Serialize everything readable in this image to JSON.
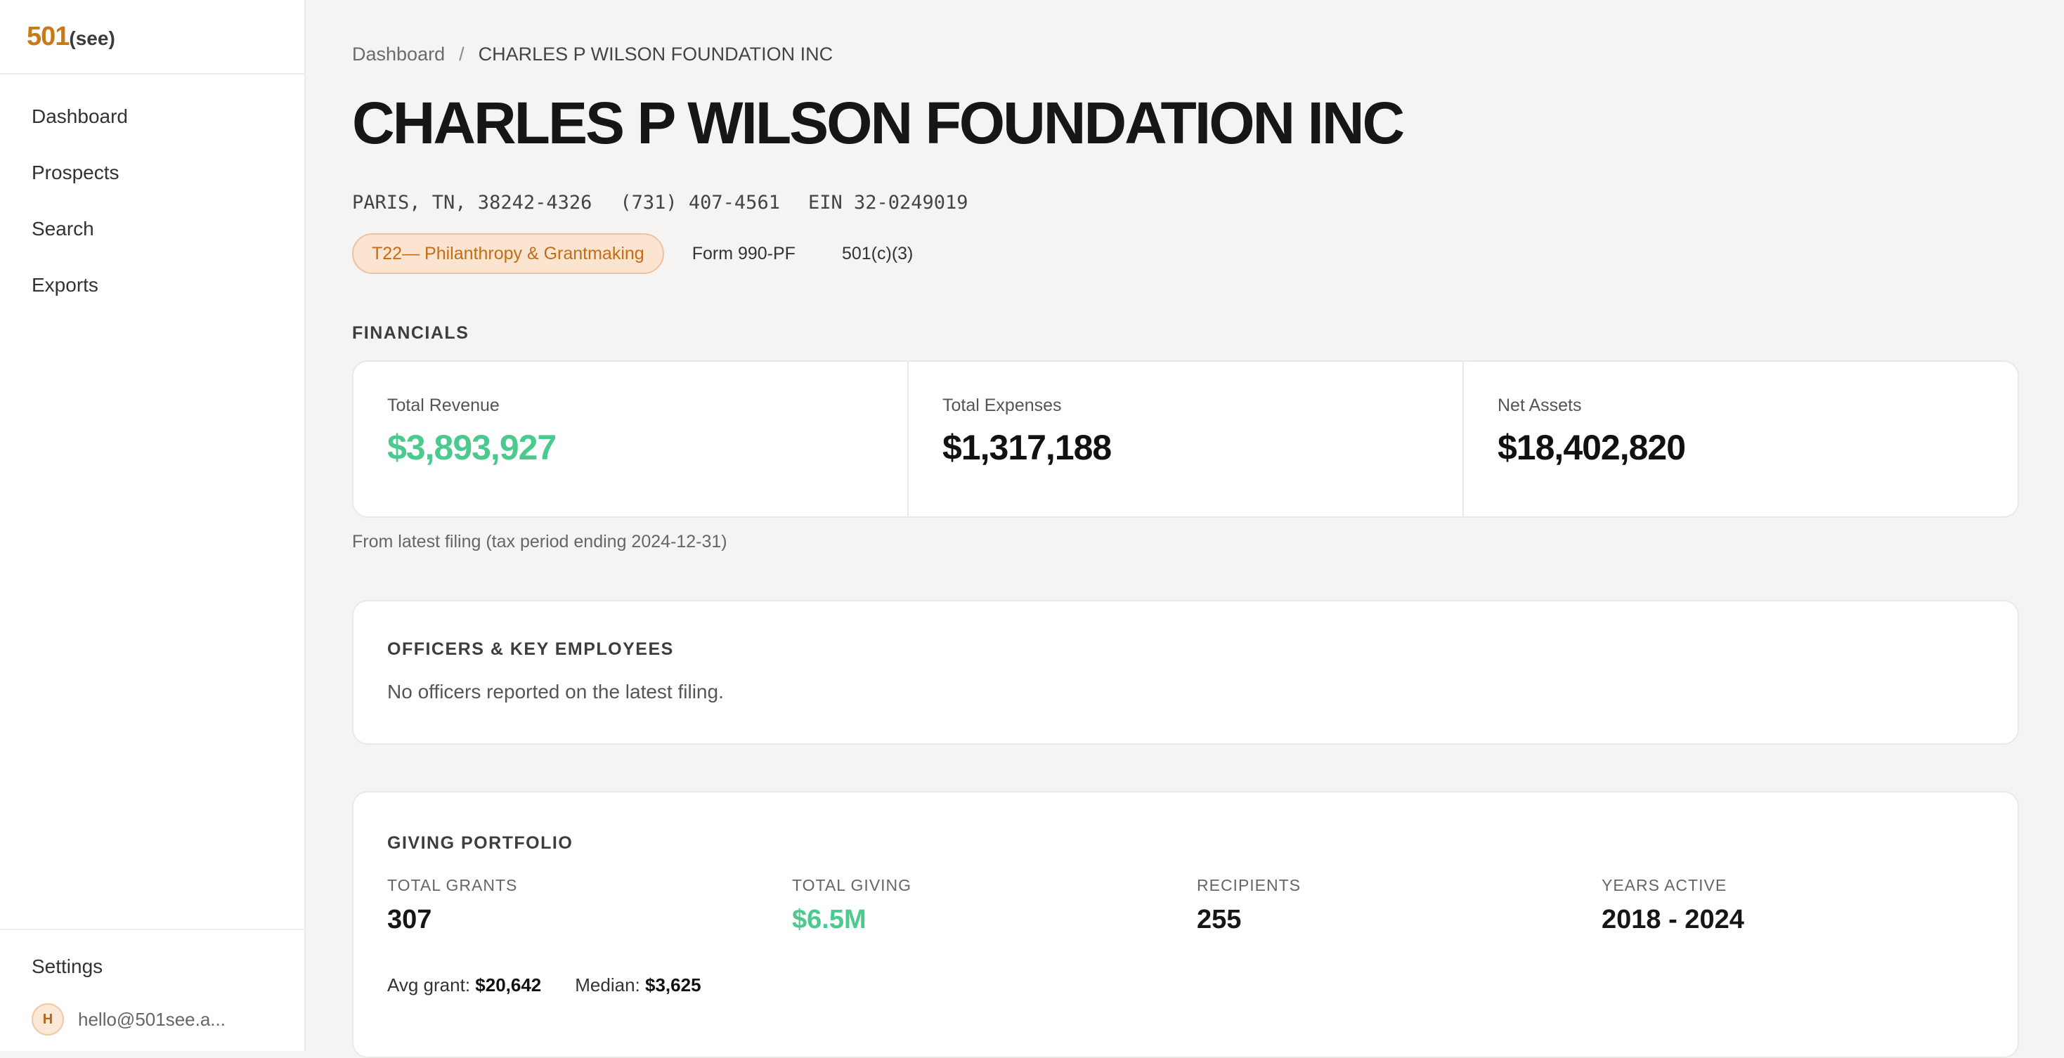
{
  "sidebar": {
    "logo": {
      "number": "501",
      "suffix": "(see)"
    },
    "nav": [
      "Dashboard",
      "Prospects",
      "Search",
      "Exports"
    ],
    "settings_label": "Settings",
    "user": {
      "initial": "H",
      "email": "hello@501see.a..."
    }
  },
  "breadcrumb": {
    "root": "Dashboard",
    "separator": "/",
    "current": "CHARLES P WILSON FOUNDATION INC"
  },
  "org": {
    "name": "CHARLES P WILSON FOUNDATION INC",
    "location": "PARIS, TN, 38242-4326",
    "phone": "(731) 407-4561",
    "ein": "EIN 32-0249019",
    "tags": [
      "T22— Philanthropy & Grantmaking",
      "Form 990-PF",
      "501(c)(3)"
    ]
  },
  "financials": {
    "heading": "FINANCIALS",
    "total_revenue": {
      "label": "Total Revenue",
      "value": "$3,893,927"
    },
    "total_expenses": {
      "label": "Total Expenses",
      "value": "$1,317,188"
    },
    "net_assets": {
      "label": "Net Assets",
      "value": "$18,402,820"
    },
    "note": "From latest filing (tax period ending 2024-12-31)"
  },
  "officers": {
    "heading": "OFFICERS & KEY EMPLOYEES",
    "empty_text": "No officers reported on the latest filing."
  },
  "giving": {
    "heading": "GIVING PORTFOLIO",
    "stats": [
      {
        "label": "TOTAL GRANTS",
        "value": "307"
      },
      {
        "label": "TOTAL GIVING",
        "value": "$6.5M"
      },
      {
        "label": "RECIPIENTS",
        "value": "255"
      },
      {
        "label": "YEARS ACTIVE",
        "value": "2018 - 2024"
      }
    ],
    "avg_label": "Avg grant:",
    "avg_value": "$20,642",
    "median_label": "Median:",
    "median_value": "$3,625"
  },
  "colors": {
    "accent": "#c8791a",
    "positive": "#4cc98d"
  }
}
